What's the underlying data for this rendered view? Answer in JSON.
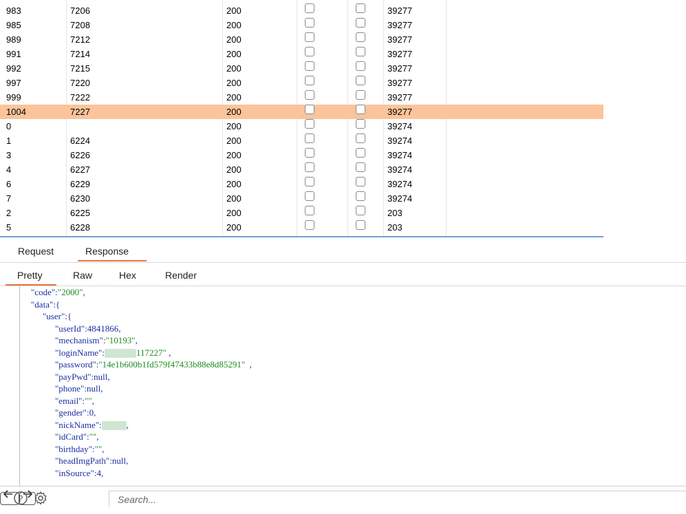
{
  "table": {
    "rows": [
      {
        "c0": "983",
        "c1": "7206",
        "c2": "200",
        "c5": "39277"
      },
      {
        "c0": "985",
        "c1": "7208",
        "c2": "200",
        "c5": "39277"
      },
      {
        "c0": "989",
        "c1": "7212",
        "c2": "200",
        "c5": "39277"
      },
      {
        "c0": "991",
        "c1": "7214",
        "c2": "200",
        "c5": "39277"
      },
      {
        "c0": "992",
        "c1": "7215",
        "c2": "200",
        "c5": "39277"
      },
      {
        "c0": "997",
        "c1": "7220",
        "c2": "200",
        "c5": "39277"
      },
      {
        "c0": "999",
        "c1": "7222",
        "c2": "200",
        "c5": "39277"
      },
      {
        "c0": "1004",
        "c1": "7227",
        "c2": "200",
        "c5": "39277",
        "selected": true
      },
      {
        "c0": "0",
        "c1": "",
        "c2": "200",
        "c5": "39274"
      },
      {
        "c0": "1",
        "c1": "6224",
        "c2": "200",
        "c5": "39274"
      },
      {
        "c0": "3",
        "c1": "6226",
        "c2": "200",
        "c5": "39274"
      },
      {
        "c0": "4",
        "c1": "6227",
        "c2": "200",
        "c5": "39274"
      },
      {
        "c0": "6",
        "c1": "6229",
        "c2": "200",
        "c5": "39274"
      },
      {
        "c0": "7",
        "c1": "6230",
        "c2": "200",
        "c5": "39274"
      },
      {
        "c0": "2",
        "c1": "6225",
        "c2": "200",
        "c5": "203"
      },
      {
        "c0": "5",
        "c1": "6228",
        "c2": "200",
        "c5": "203"
      }
    ],
    "selected_color": "#fbc49a"
  },
  "message_tabs": {
    "request": "Request",
    "response": "Response",
    "active": "Response"
  },
  "view_tabs": {
    "pretty": "Pretty",
    "raw": "Raw",
    "hex": "Hex",
    "render": "Render",
    "active": "Pretty"
  },
  "json_lines": [
    {
      "indent": 1,
      "key": "\"code\"",
      "sep": ":",
      "value": "\"2000\"",
      "vtype": "s",
      "tail": ","
    },
    {
      "indent": 1,
      "key": "\"data\"",
      "sep": ":{",
      "value": "",
      "vtype": "",
      "tail": ""
    },
    {
      "indent": 2,
      "key": "\"user\"",
      "sep": ":{",
      "value": "",
      "vtype": "",
      "tail": ""
    },
    {
      "indent": 3,
      "key": "\"userId\"",
      "sep": ":",
      "value": "4841866",
      "vtype": "n",
      "tail": ","
    },
    {
      "indent": 3,
      "key": "\"mechanism\"",
      "sep": ":",
      "value": "\"10193\"",
      "vtype": "s",
      "tail": ","
    },
    {
      "indent": 3,
      "key": "\"loginName\"",
      "sep": ":",
      "value": "117227\"",
      "vtype": "s",
      "tail": " ,",
      "redact": true
    },
    {
      "indent": 3,
      "key": "\"password\"",
      "sep": ":",
      "value": "\"14e1b600b1fd579f47433b88e8d85291\"",
      "vtype": "s",
      "tail": "  ,"
    },
    {
      "indent": 3,
      "key": "\"payPwd\"",
      "sep": ":",
      "value": "null",
      "vtype": "k",
      "tail": ","
    },
    {
      "indent": 3,
      "key": "\"phone\"",
      "sep": ":",
      "value": "null",
      "vtype": "k",
      "tail": ","
    },
    {
      "indent": 3,
      "key": "\"email\"",
      "sep": ":",
      "value": "\"\"",
      "vtype": "s",
      "tail": ","
    },
    {
      "indent": 3,
      "key": "\"gender\"",
      "sep": ":",
      "value": "0",
      "vtype": "k",
      "tail": ","
    },
    {
      "indent": 3,
      "key": "\"nickName\"",
      "sep": ":",
      "value": "",
      "vtype": "s",
      "tail": ",",
      "redact_small": true
    },
    {
      "indent": 3,
      "key": "\"idCard\"",
      "sep": ":",
      "value": "\"\"",
      "vtype": "s",
      "tail": ","
    },
    {
      "indent": 3,
      "key": "\"birthday\"",
      "sep": ":",
      "value": "\"\"",
      "vtype": "s",
      "tail": ","
    },
    {
      "indent": 3,
      "key": "\"headImgPath\"",
      "sep": ":",
      "value": "null",
      "vtype": "k",
      "tail": ","
    },
    {
      "indent": 3,
      "key": "\"inSource\"",
      "sep": ":",
      "value": "4",
      "vtype": "k",
      "tail": ","
    }
  ],
  "toolbar": {
    "help_icon": "help-icon",
    "gear_icon": "gear-icon",
    "back_arrow": "←",
    "forward_arrow": "→",
    "search_placeholder": "Search..."
  }
}
